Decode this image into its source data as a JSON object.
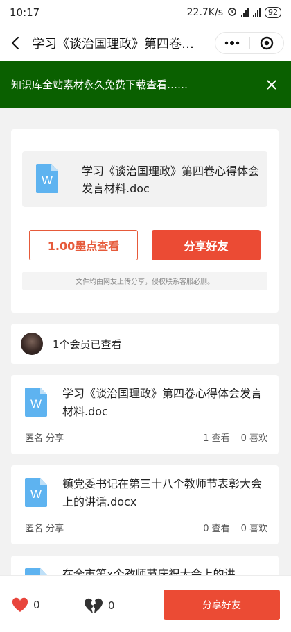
{
  "status_bar": {
    "time": "10:17",
    "speed": "22.7K/s",
    "battery": "92"
  },
  "nav": {
    "title": "学习《谈治国理政》第四卷…"
  },
  "banner": {
    "text": "知识库全站素材永久免费下载查看……"
  },
  "main_card": {
    "file_name": "学习《谈治国理政》第四卷心得体会发言材料.doc",
    "file_icon_letter": "W",
    "view_button_label": "1.00墨点查看",
    "share_button_label": "分享好友",
    "notice": "文件均由网友上传分享，侵权联系客服必删。"
  },
  "viewers": {
    "text": "1个会员已查看"
  },
  "related": [
    {
      "title": "学习《谈治国理政》第四卷心得体会发言材料.doc",
      "meta": "匿名 分享",
      "views": "1 查看",
      "likes": "0 喜欢",
      "icon_letter": "W"
    },
    {
      "title": "镇党委书记在第三十八个教师节表彰大会上的讲话.docx",
      "meta": "匿名 分享",
      "views": "0 查看",
      "likes": "0 喜欢",
      "icon_letter": "W"
    },
    {
      "title": "在全市第x个教师节庆祝大会上的讲",
      "icon_letter": "W"
    }
  ],
  "bottom_bar": {
    "like_count": "0",
    "dislike_count": "0",
    "share_label": "分享好友"
  },
  "colors": {
    "banner_bg": "#0a6000",
    "accent_red": "#eb4b34",
    "doc_icon_blue": "#5eb3f0"
  }
}
